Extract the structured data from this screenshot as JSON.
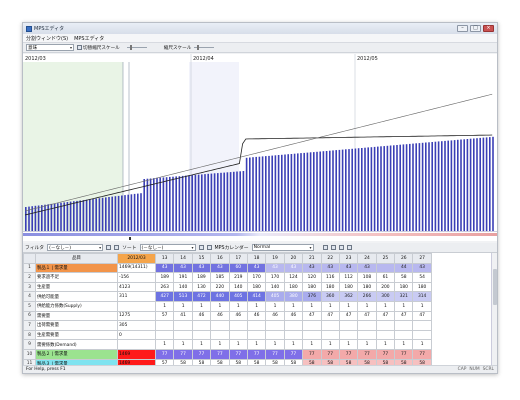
{
  "window": {
    "title": "MPSエディタ",
    "controls": [
      "–",
      "□",
      "×"
    ]
  },
  "menu": [
    "分割ウィンドウ(S)",
    "MPSエディタ"
  ],
  "toolbar": {
    "select_value": "意味",
    "cycle_scale_label": "切替縮尺スケール",
    "scale_label": "縮尺スケール"
  },
  "chart": {
    "months": [
      "2012/03",
      "2012/04",
      "2012/05"
    ],
    "colors": {
      "bar": "#3b3fb6",
      "line": "#222222",
      "shade": "#e7f3e4"
    }
  },
  "filterbar": {
    "filter_label": "フィルタ",
    "filter_value": "(－なし－)",
    "sort_label": "ソート",
    "sort_value": "(－なし－)",
    "calendar_label": "MPSカレンダー",
    "calendar_value": "Normal"
  },
  "grid": {
    "header": {
      "name": "品目",
      "value": "2012/03",
      "days": [
        "13",
        "14",
        "15",
        "16",
        "17",
        "18",
        "19",
        "20",
        "21",
        "22",
        "23",
        "24",
        "25",
        "26",
        "27"
      ],
      "today": "20"
    },
    "rows": [
      {
        "n": "1",
        "name": "製品１ | 需求量",
        "value": "1469(14311)",
        "cells": [
          "43",
          "43",
          "43",
          "43",
          "60",
          "43",
          "43",
          "43",
          "43",
          "43",
          "43",
          "43",
          "",
          "44",
          "43"
        ],
        "nameBg": "#f2944a",
        "valBg": "#ffffff",
        "rowBg": "#7f7fe6"
      },
      {
        "n": "2",
        "name": "要求過不足",
        "value": "-156",
        "cells": [
          "189",
          "191",
          "189",
          "185",
          "219",
          "170",
          "170",
          "124",
          "120",
          "116",
          "112",
          "108",
          "61",
          "58",
          "54"
        ],
        "rowBg": "#ffffff"
      },
      {
        "n": "3",
        "name": "生産量",
        "value": "4123",
        "cells": [
          "263",
          "140",
          "130",
          "220",
          "140",
          "180",
          "140",
          "180",
          "180",
          "180",
          "180",
          "180",
          "200",
          "180",
          "180"
        ],
        "rowBg": "#ffffff"
      },
      {
        "n": "4",
        "name": "供給可能量",
        "value": "311",
        "cells": [
          "427",
          "513",
          "472",
          "440",
          "405",
          "414",
          "405",
          "380",
          "376",
          "360",
          "362",
          "266",
          "300",
          "321",
          "314"
        ],
        "rowBg": "#6d73e2"
      },
      {
        "n": "5",
        "name": "供給能力係数(Supply)",
        "value": "",
        "cells": [
          "1",
          "1",
          "1",
          "1",
          "1",
          "1",
          "1",
          "1",
          "1",
          "1",
          "1",
          "1",
          "1",
          "1",
          "1"
        ],
        "rowBg": "#ffffff"
      },
      {
        "n": "6",
        "name": "需要量",
        "value": "1275",
        "cells": [
          "57",
          "41",
          "46",
          "46",
          "46",
          "46",
          "46",
          "46",
          "47",
          "47",
          "47",
          "47",
          "47",
          "47",
          "47"
        ],
        "rowBg": "#ffffff"
      },
      {
        "n": "7",
        "name": "出荷需要量",
        "value": "305",
        "cells": [
          "",
          "",
          "",
          "",
          "",
          "",
          "",
          "",
          "",
          "",
          "",
          "",
          "",
          "",
          ""
        ],
        "rowBg": "#ffffff"
      },
      {
        "n": "8",
        "name": "生産需要量",
        "value": "0",
        "cells": [
          "",
          "",
          "",
          "",
          "",
          "",
          "",
          "",
          "",
          "",
          "",
          "",
          "",
          "",
          ""
        ],
        "rowBg": "#ffffff"
      },
      {
        "n": "9",
        "name": "需要係数(Demand)",
        "value": "",
        "cells": [
          "1",
          "1",
          "1",
          "1",
          "1",
          "1",
          "1",
          "1",
          "1",
          "1",
          "1",
          "1",
          "1",
          "1",
          "1"
        ],
        "rowBg": "#ffffff"
      },
      {
        "n": "10",
        "name": "製品２ | 需求量",
        "value": "1469",
        "cells": [
          "77",
          "77",
          "77",
          "77",
          "77",
          "77",
          "77",
          "77",
          "77",
          "77",
          "77",
          "77",
          "77",
          "77",
          "77"
        ],
        "nameBg": "#9be38f",
        "valBg": "#ff1a1a",
        "rowBg": "#8b7ae8"
      },
      {
        "n": "11",
        "name": "製品３ | 需求量",
        "value": "1469",
        "cells": [
          "57",
          "58",
          "58",
          "58",
          "58",
          "58",
          "58",
          "58",
          "58",
          "58",
          "58",
          "58",
          "58",
          "58",
          "58"
        ],
        "nameBg": "#7fe3f0",
        "valBg": "#ff1a1a",
        "rowBg": "#f4b8b8"
      }
    ]
  },
  "status": {
    "help": "For Help, press F1",
    "indicators": [
      "CAP",
      "NUM",
      "SCRL"
    ]
  }
}
